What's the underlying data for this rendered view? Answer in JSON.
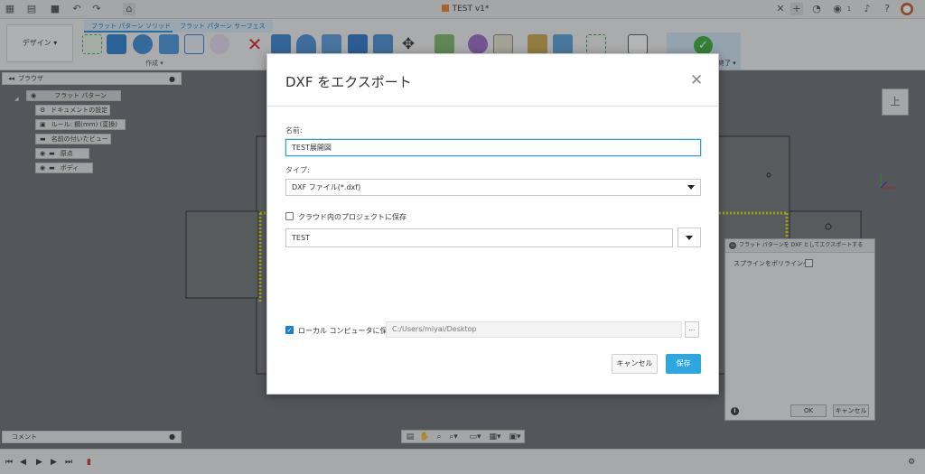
{
  "app": {
    "doc_tab_title": "TEST v1*",
    "user_badge": "1"
  },
  "toolbar": {
    "design_label": "デザイン ▾",
    "tabs": [
      "フラット パターン ソリッド",
      "フラット パターン サーフェス"
    ],
    "create_group_label": "作成 ▾",
    "finish_label": "終了 ▾"
  },
  "browser": {
    "title": "ブラウザ",
    "items": [
      "フラット パターン",
      "ドキュメントの設定",
      "ルール: 鋼(mm) (変換)",
      "名前の付いたビュー",
      "原点",
      "ボディ"
    ]
  },
  "viewcube": {
    "face_label": "上"
  },
  "comment_bar": {
    "label": "コメント"
  },
  "side_dialog": {
    "title": "フラット パターンを DXF としてエクスポートする",
    "option_label": "スプラインをポリラインへ",
    "ok_label": "OK",
    "cancel_label": "キャンセル"
  },
  "modal": {
    "title": "DXF をエクスポート",
    "name_label": "名前:",
    "name_value": "TEST展開図",
    "type_label": "タイプ:",
    "type_value": "DXF ファイル(*.dxf)",
    "cloud_checkbox_label": "クラウド内のプロジェクトに保存",
    "cloud_project": "TEST",
    "local_checkbox_label": "ローカル コンピュータに保存",
    "local_path": "C:/Users/miyai/Desktop",
    "browse_label": "...",
    "cancel_label": "キャンセル",
    "save_label": "保存"
  },
  "colors": {
    "accent": "#2ea7e0",
    "finish_green": "#3cae3a",
    "canvas_bg": "#6b6e73",
    "selection_yellow": "#f5f000"
  }
}
